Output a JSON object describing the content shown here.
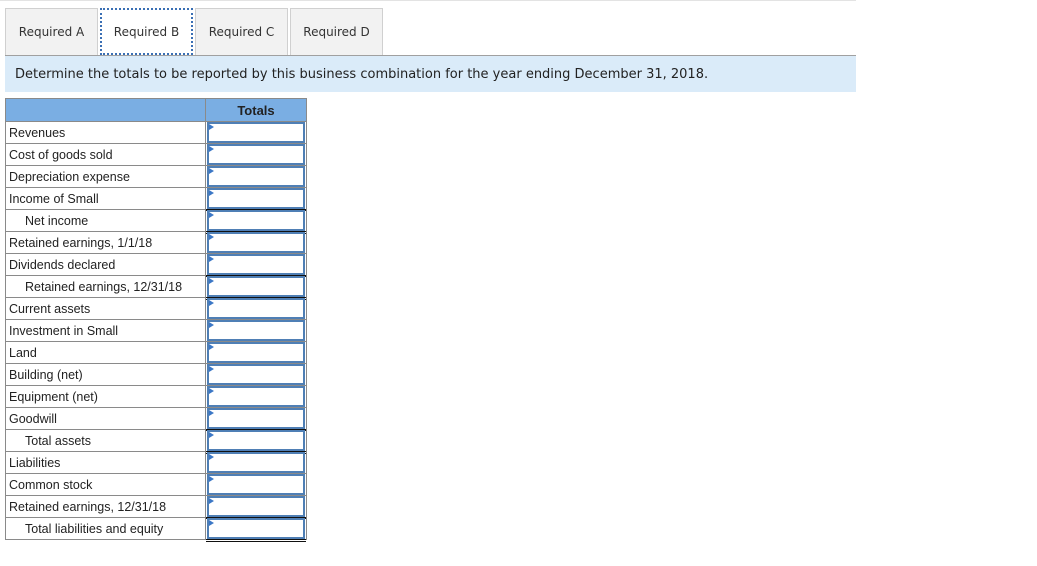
{
  "tabs": [
    {
      "label": "Required A",
      "active": false
    },
    {
      "label": "Required B",
      "active": true
    },
    {
      "label": "Required C",
      "active": false
    },
    {
      "label": "Required D",
      "active": false
    }
  ],
  "instruction": "Determine the totals to be reported by this business combination for the year ending December 31, 2018.",
  "table": {
    "header": {
      "label_col": "",
      "value_col": "Totals"
    },
    "rows": [
      {
        "label": "Revenues",
        "value": ""
      },
      {
        "label": "Cost of goods sold",
        "value": ""
      },
      {
        "label": "Depreciation expense",
        "value": ""
      },
      {
        "label": "Income of Small",
        "value": ""
      },
      {
        "label": "Net income",
        "value": ""
      },
      {
        "label": "Retained earnings, 1/1/18",
        "value": ""
      },
      {
        "label": "Dividends declared",
        "value": ""
      },
      {
        "label": "Retained earnings, 12/31/18",
        "value": ""
      },
      {
        "label": "Current assets",
        "value": ""
      },
      {
        "label": "Investment in Small",
        "value": ""
      },
      {
        "label": "Land",
        "value": ""
      },
      {
        "label": "Building (net)",
        "value": ""
      },
      {
        "label": "Equipment (net)",
        "value": ""
      },
      {
        "label": "Goodwill",
        "value": ""
      },
      {
        "label": "Total assets",
        "value": ""
      },
      {
        "label": "Liabilities",
        "value": ""
      },
      {
        "label": "Common stock",
        "value": ""
      },
      {
        "label": "Retained earnings, 12/31/18",
        "value": ""
      },
      {
        "label": "Total liabilities and equity",
        "value": ""
      }
    ]
  },
  "colors": {
    "header_bg": "#7aaee3",
    "instruction_bg": "#daebf9",
    "input_border": "#4f7fb5"
  }
}
